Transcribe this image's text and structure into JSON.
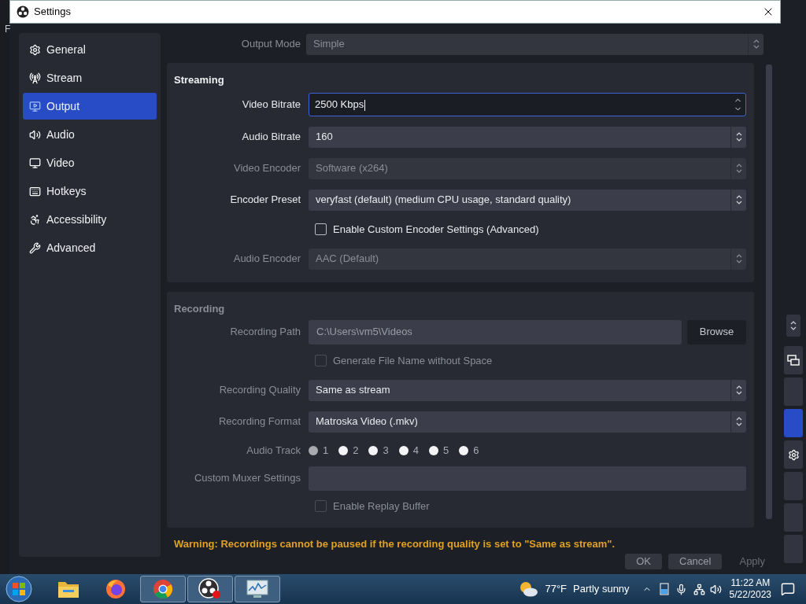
{
  "background_menu": "F",
  "window": {
    "title": "Settings"
  },
  "sidebar": {
    "items": [
      {
        "label": "General",
        "selected": false
      },
      {
        "label": "Stream",
        "selected": false
      },
      {
        "label": "Output",
        "selected": true
      },
      {
        "label": "Audio",
        "selected": false
      },
      {
        "label": "Video",
        "selected": false
      },
      {
        "label": "Hotkeys",
        "selected": false
      },
      {
        "label": "Accessibility",
        "selected": false
      },
      {
        "label": "Advanced",
        "selected": false
      }
    ]
  },
  "output_mode": {
    "label": "Output Mode",
    "value": "Simple",
    "disabled": true
  },
  "groups": [
    {
      "title": "Streaming",
      "disabled": false,
      "rows": [
        {
          "kind": "spin",
          "label": "Video Bitrate",
          "value": "2500 Kbps",
          "focused": true,
          "disabled": false
        },
        {
          "kind": "combo",
          "label": "Audio Bitrate",
          "value": "160",
          "disabled": false
        },
        {
          "kind": "combo",
          "label": "Video Encoder",
          "value": "Software (x264)",
          "disabled": true
        },
        {
          "kind": "combo",
          "label": "Encoder Preset",
          "value": "veryfast (default) (medium CPU usage, standard quality)",
          "disabled": false
        },
        {
          "kind": "checkbox",
          "label": "Enable Custom Encoder Settings (Advanced)",
          "checked": false,
          "disabled": false
        },
        {
          "kind": "combo",
          "label": "Audio Encoder",
          "value": "AAC (Default)",
          "disabled": true
        }
      ]
    },
    {
      "title": "Recording",
      "disabled": true,
      "rows": [
        {
          "kind": "path",
          "label": "Recording Path",
          "value": "C:\\Users\\vm5\\Videos",
          "button": "Browse",
          "disabled": true
        },
        {
          "kind": "checkbox",
          "label": "Generate File Name without Space",
          "checked": false,
          "disabled": true
        },
        {
          "kind": "combo",
          "label": "Recording Quality",
          "value": "Same as stream",
          "disabled": false
        },
        {
          "kind": "combo",
          "label": "Recording Format",
          "value": "Matroska Video (.mkv)",
          "disabled": false
        },
        {
          "kind": "radios",
          "label": "Audio Track",
          "options": [
            {
              "label": "1",
              "selected": true
            },
            {
              "label": "2",
              "selected": false
            },
            {
              "label": "3",
              "selected": false
            },
            {
              "label": "4",
              "selected": false
            },
            {
              "label": "5",
              "selected": false
            },
            {
              "label": "6",
              "selected": false
            }
          ]
        },
        {
          "kind": "text",
          "label": "Custom Muxer Settings"
        },
        {
          "kind": "checkbox",
          "label": "Enable Replay Buffer",
          "checked": false,
          "disabled": true
        }
      ]
    }
  ],
  "warning": "Warning: Recordings cannot be paused if the recording quality is set to \"Same as stream\".",
  "buttons": [
    {
      "label": "OK",
      "disabled": false
    },
    {
      "label": "Cancel",
      "disabled": false
    },
    {
      "label": "Apply",
      "disabled": true
    }
  ],
  "side_dock": [
    {
      "kind": "spin",
      "selected": false
    },
    {
      "kind": "windows",
      "selected": false
    },
    {
      "kind": "blank",
      "selected": false
    },
    {
      "kind": "blank",
      "selected": true
    },
    {
      "kind": "gear",
      "selected": false
    },
    {
      "kind": "blank",
      "selected": false
    },
    {
      "kind": "blank",
      "selected": false
    },
    {
      "kind": "blank",
      "selected": false
    }
  ],
  "taskbar": {
    "apps": [
      {
        "running": false
      },
      {
        "running": false
      },
      {
        "running": true
      },
      {
        "running": true
      },
      {
        "running": true
      }
    ],
    "weather": {
      "temperature": "77°F",
      "condition": "Partly sunny"
    },
    "clock": {
      "time": "11:22 AM",
      "date": "5/22/2023"
    }
  }
}
